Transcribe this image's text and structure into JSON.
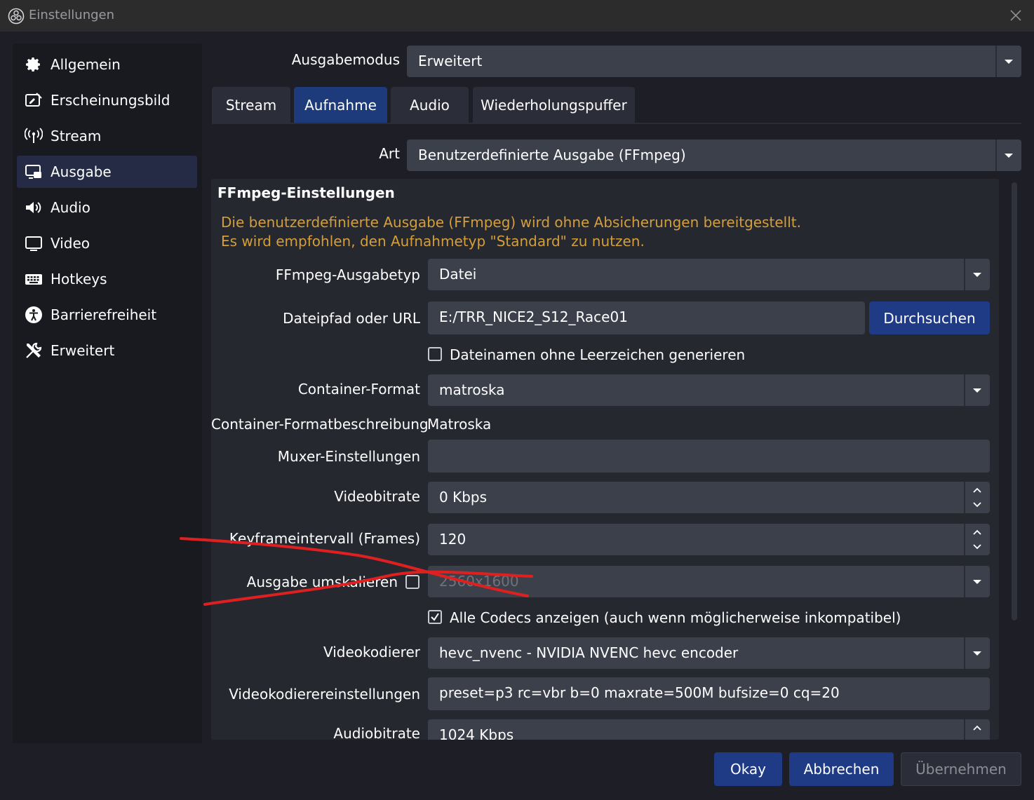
{
  "window": {
    "title": "Einstellungen"
  },
  "sidebar": {
    "items": [
      {
        "label": "Allgemein",
        "icon": "gear-icon"
      },
      {
        "label": "Erscheinungsbild",
        "icon": "appearance-icon"
      },
      {
        "label": "Stream",
        "icon": "antenna-icon"
      },
      {
        "label": "Ausgabe",
        "icon": "output-icon",
        "active": true
      },
      {
        "label": "Audio",
        "icon": "speaker-icon"
      },
      {
        "label": "Video",
        "icon": "monitor-icon"
      },
      {
        "label": "Hotkeys",
        "icon": "keyboard-icon"
      },
      {
        "label": "Barrierefreiheit",
        "icon": "accessibility-icon"
      },
      {
        "label": "Erweitert",
        "icon": "tools-icon"
      }
    ]
  },
  "output_mode": {
    "label": "Ausgabemodus",
    "value": "Erweitert"
  },
  "tabs": [
    {
      "label": "Stream"
    },
    {
      "label": "Aufnahme",
      "active": true
    },
    {
      "label": "Audio"
    },
    {
      "label": "Wiederholungspuffer"
    }
  ],
  "type": {
    "label": "Art",
    "value": "Benutzerdefinierte Ausgabe (FFmpeg)"
  },
  "ffmpeg": {
    "title": "FFmpeg-Einstellungen",
    "warning_line1": "Die benutzerdefinierte Ausgabe (FFmpeg) wird ohne Absicherungen bereitgestellt.",
    "warning_line2": "Es wird empfohlen, den Aufnahmetyp \"Standard\" zu nutzen.",
    "output_type": {
      "label": "FFmpeg-Ausgabetyp",
      "value": "Datei"
    },
    "path": {
      "label": "Dateipfad oder URL",
      "value": "E:/TRR_NICE2_S12_Race01",
      "browse": "Durchsuchen"
    },
    "no_spaces": {
      "label": "Dateinamen ohne Leerzeichen generieren",
      "checked": false
    },
    "container": {
      "label": "Container-Format",
      "value": "matroska"
    },
    "container_desc": {
      "label": "Container-Formatbeschreibung",
      "value": "Matroska"
    },
    "muxer": {
      "label": "Muxer-Einstellungen",
      "value": ""
    },
    "video_bitrate": {
      "label": "Videobitrate",
      "value": "0 Kbps"
    },
    "keyframe": {
      "label": "Keyframeintervall (Frames)",
      "value": "120"
    },
    "rescale": {
      "label": "Ausgabe umskalieren",
      "value": "2560x1600",
      "checked": false
    },
    "all_codecs": {
      "label": "Alle Codecs anzeigen (auch wenn möglicherweise inkompatibel)",
      "checked": true
    },
    "video_encoder": {
      "label": "Videokodierer",
      "value": "hevc_nvenc - NVIDIA NVENC hevc encoder"
    },
    "video_encoder_settings": {
      "label": "Videokodierereinstellungen",
      "value": "preset=p3 rc=vbr b=0 maxrate=500M bufsize=0 cq=20"
    },
    "audio_bitrate": {
      "label": "Audiobitrate",
      "value": "1024 Kbps"
    }
  },
  "footer": {
    "ok": "Okay",
    "cancel": "Abbrechen",
    "apply": "Übernehmen"
  },
  "colors": {
    "accent": "#1f3b86",
    "warning": "#d49e3a",
    "annotation": "#e02020"
  }
}
